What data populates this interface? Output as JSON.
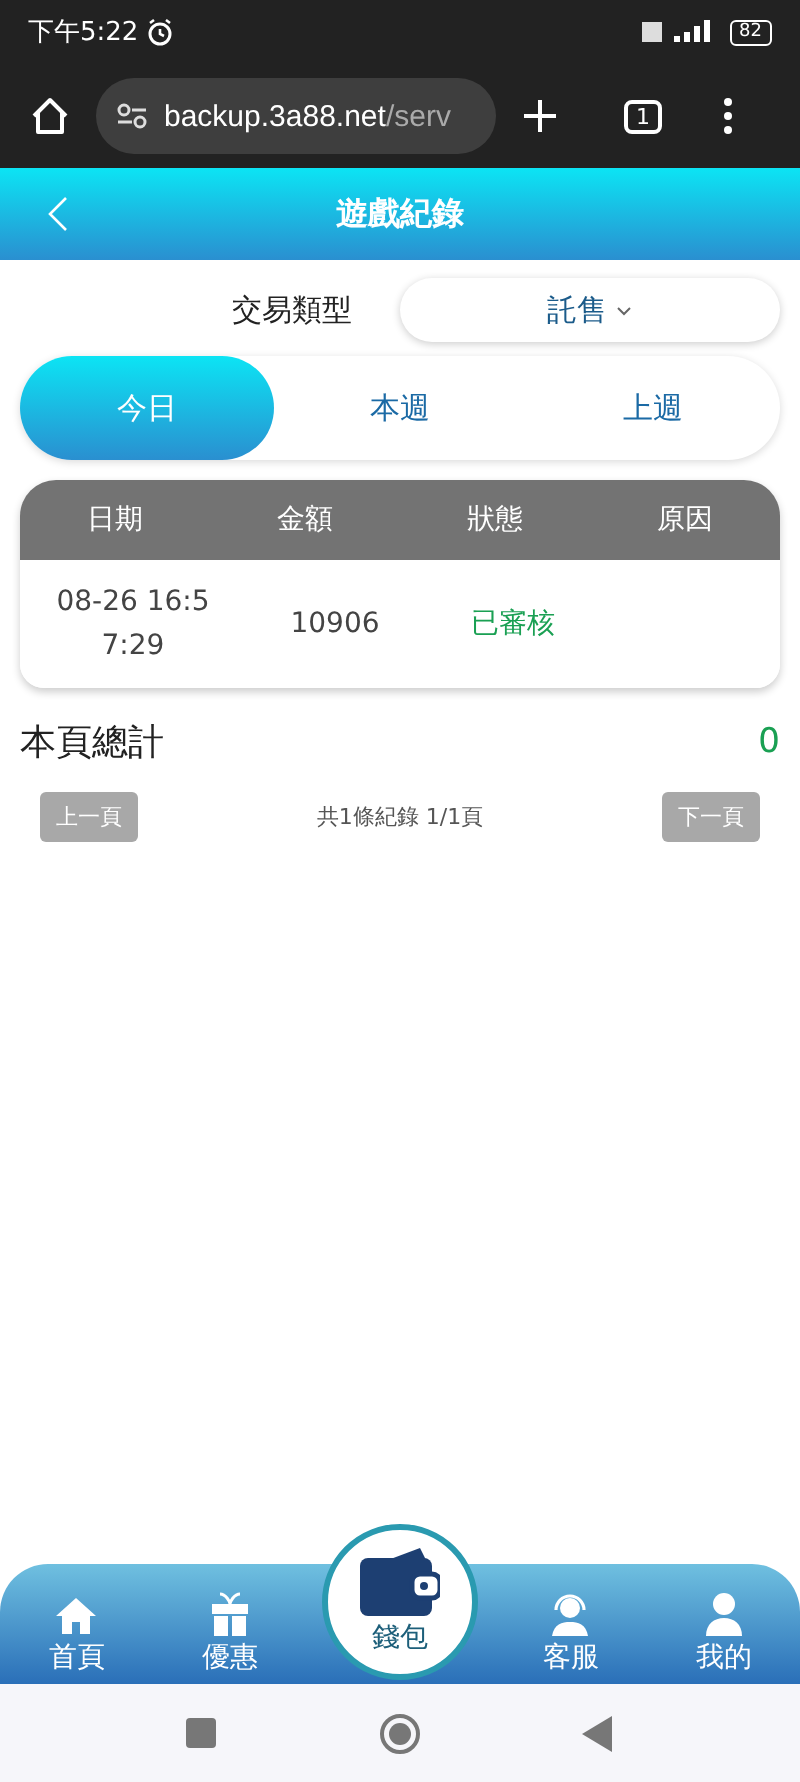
{
  "status_bar": {
    "time": "下午5:22",
    "battery": "82"
  },
  "browser": {
    "url_host": "backup.3a88.net",
    "url_path": "/serv",
    "tab_count": "1"
  },
  "header": {
    "title": "遊戲紀錄"
  },
  "filter": {
    "label": "交易類型",
    "value": "託售"
  },
  "tabs": [
    {
      "label": "今日",
      "selected": true
    },
    {
      "label": "本週",
      "selected": false
    },
    {
      "label": "上週",
      "selected": false
    }
  ],
  "table": {
    "columns": [
      "日期",
      "金額",
      "狀態",
      "原因"
    ],
    "rows": [
      {
        "date": "08-26 16:57:29",
        "amount": "10906",
        "status": "已審核"
      }
    ]
  },
  "summary": {
    "label": "本頁總計",
    "value": "0"
  },
  "pager": {
    "prev": {
      "label": "上一頁",
      "disabled": true
    },
    "info": "共1條紀錄 1/1頁",
    "next": {
      "label": "下一頁",
      "disabled": true
    }
  },
  "bottom_nav": [
    {
      "label": "首頁",
      "kind": "tab"
    },
    {
      "label": "優惠",
      "kind": "tab"
    },
    {
      "label": "錢包",
      "kind": "center"
    },
    {
      "label": "客服",
      "kind": "tab"
    },
    {
      "label": "我的",
      "kind": "tab"
    }
  ]
}
